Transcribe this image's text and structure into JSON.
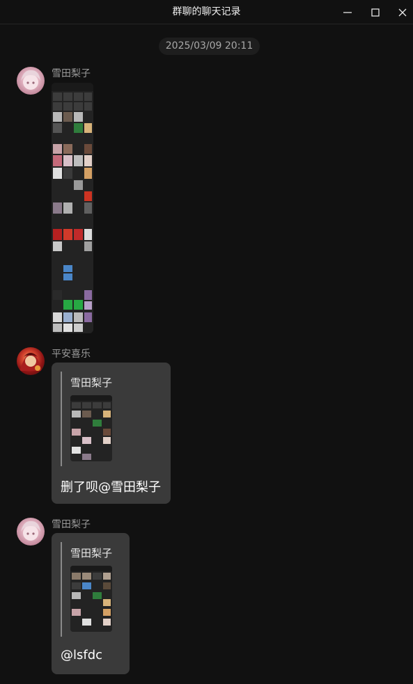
{
  "window": {
    "title": "群聊的聊天记录",
    "minimize_icon": "minimize-icon",
    "maximize_icon": "maximize-icon",
    "close_icon": "close-icon"
  },
  "timestamp": "2025/03/09 20:11",
  "messages": [
    {
      "sender": "雪田梨子",
      "type": "image"
    },
    {
      "sender": "平安喜乐",
      "type": "reply",
      "quote_sender": "雪田梨子",
      "text": "删了呗@雪田梨子"
    },
    {
      "sender": "雪田梨子",
      "type": "reply",
      "quote_sender": "雪田梨子",
      "text": "@lsfdc"
    }
  ]
}
